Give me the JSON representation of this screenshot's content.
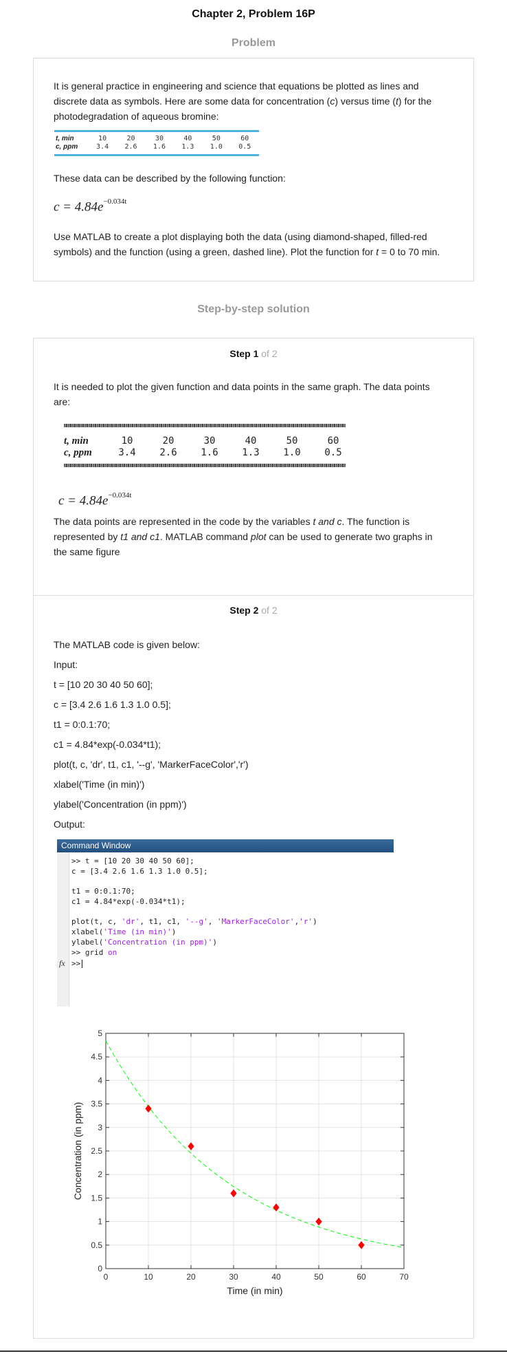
{
  "header": {
    "title": "Chapter 2, Problem 16P",
    "problem_heading": "Problem",
    "solution_heading": "Step-by-step solution"
  },
  "problem": {
    "intro_1": "It is general practice in engineering and science that equations be plotted as lines and",
    "intro_2": "discrete data as symbols. Here are some data for concentration (",
    "intro_var_c": "c",
    "intro_3": ") versus time (",
    "intro_var_t": "t",
    "intro_4": ") for the",
    "intro_5": "photodegradation of aqueous bromine:",
    "table": {
      "row1_label": "t, min",
      "row2_label": "c, ppm",
      "t_values": [
        "10",
        "20",
        "30",
        "40",
        "50",
        "60"
      ],
      "c_values": [
        "3.4",
        "2.6",
        "1.6",
        "1.3",
        "1.0",
        "0.5"
      ]
    },
    "describe": "These data can be described by the following function:",
    "formula_lhs": "c = 4.84e",
    "formula_exp": "−0.034t",
    "task_1": "Use MATLAB to create a plot displaying both the data (using diamond-shaped, filled-red",
    "task_2a": "symbols) and the function (using a green, dashed line). Plot the function for ",
    "task_var_t": "t",
    "task_2b": " = 0 to 70 min."
  },
  "step1": {
    "step_label": "Step 1",
    "of_label": "of 2",
    "text_1": "It is needed to plot the given function and data points in the same graph. The data points",
    "text_2": "are:",
    "scan_row1_label": "t, min",
    "scan_row2_label": "c, ppm",
    "formula_lhs": "c = 4.84e",
    "formula_exp": "−0.034t",
    "text_3a": "The data points are represented in the code by the variables ",
    "text_3_var": "t and c",
    "text_3b": ". The function is",
    "text_4a": "represented by ",
    "text_4_var": "t1 and c1",
    "text_4b": ". MATLAB command ",
    "text_4_cmd": "plot",
    "text_4c": " can be used to generate two graphs in",
    "text_5": "the same figure"
  },
  "step2": {
    "step_label": "Step 2",
    "of_label": "of 2",
    "lines": [
      "The MATLAB code is given below:",
      "Input:",
      "t = [10 20 30 40 50 60];",
      "c = [3.4 2.6 1.6 1.3 1.0 0.5];",
      "t1 = 0:0.1:70;",
      "c1 = 4.84*exp(-0.034*t1);",
      "plot(t, c, 'dr', t1, c1, '--g', 'MarkerFaceColor','r')",
      "xlabel('Time (in min)')",
      "ylabel('Concentration (in ppm)')",
      "Output:"
    ]
  },
  "command_window": {
    "title": "Command Window",
    "line1": ">> t = [10 20 30 40 50 60];",
    "line2": "c = [3.4 2.6 1.6 1.3 1.0 0.5];",
    "line3": "t1 = 0:0.1:70;",
    "line4": "c1 = 4.84*exp(-0.034*t1);",
    "line5_a": "plot(t, c, ",
    "line5_s1": "'dr'",
    "line5_b": ", t1, c1, ",
    "line5_s2": "'--g'",
    "line5_c": ", ",
    "line5_s3": "'MarkerFaceColor'",
    "line5_d": ",",
    "line5_s4": "'r'",
    "line5_e": ")",
    "line6_a": "xlabel(",
    "line6_s": "'Time (in min)'",
    "line6_b": ")",
    "line7_a": "ylabel(",
    "line7_s": "'Concentration (in ppm)'",
    "line7_b": ")",
    "line8_a": ">> grid ",
    "line8_s": "on",
    "fx_label": "fx",
    "prompt": ">>"
  },
  "chart_data": {
    "type": "scatter",
    "xlabel": "Time (in min)",
    "ylabel": "Concentration (in ppm)",
    "xlim": [
      0,
      70
    ],
    "ylim": [
      0,
      5
    ],
    "x_ticks": [
      "0",
      "10",
      "20",
      "30",
      "40",
      "50",
      "60",
      "70"
    ],
    "y_ticks": [
      "0",
      "0.5",
      "1",
      "1.5",
      "2",
      "2.5",
      "3",
      "3.5",
      "4",
      "4.5",
      "5"
    ],
    "grid": true,
    "series": [
      {
        "type": "scatter",
        "marker": "diamond",
        "color": "#ff0000",
        "x": [
          10,
          20,
          30,
          40,
          50,
          60
        ],
        "y": [
          3.4,
          2.6,
          1.6,
          1.3,
          1.0,
          0.5
        ]
      },
      {
        "type": "line",
        "style": "dashed",
        "color": "#00ff00",
        "function": "4.84*exp(-0.034*t)",
        "x_range": [
          0,
          70
        ]
      }
    ]
  }
}
